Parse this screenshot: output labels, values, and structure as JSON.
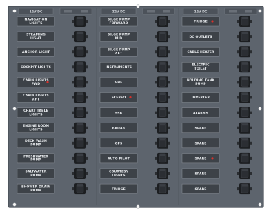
{
  "panel": {
    "header_label": "12V DC",
    "colors": {
      "panel": "#5d646d",
      "panel_edge": "#454b53",
      "label_plate": "#3d4248",
      "label_border": "#8a9098",
      "text": "#e9ecef",
      "led_red": "#d8322c",
      "switch_body": "#1c1e21",
      "switch_rocker": "#2b2e33",
      "screw": "#f4f4f4"
    }
  },
  "columns": [
    {
      "header": "12V DC",
      "items": [
        {
          "label": [
            "NAVIGATION",
            "LIGHTS"
          ],
          "led": false
        },
        {
          "label": [
            "STEAMING",
            "LIGHT"
          ],
          "led": false
        },
        {
          "label": [
            "ANCHOR LIGHT"
          ],
          "led": false
        },
        {
          "label": [
            "COCKPIT LIGHTS"
          ],
          "led": false
        },
        {
          "label": [
            "CABIN LIGHTS",
            "FWD"
          ],
          "led": true
        },
        {
          "label": [
            "CABIN LIGHTS",
            "AFT"
          ],
          "led": false
        },
        {
          "label": [
            "CHART TABLE",
            "LIGHTS"
          ],
          "led": false
        },
        {
          "label": [
            "ENGINE ROOM",
            "LIGHTS"
          ],
          "led": false
        },
        {
          "label": [
            "DECK WASH",
            "PUMP"
          ],
          "led": false
        },
        {
          "label": [
            "FRESHWATER",
            "PUMP"
          ],
          "led": false
        },
        {
          "label": [
            "SALTWATER",
            "PUMP"
          ],
          "led": false
        },
        {
          "label": [
            "SHOWER DRAIN",
            "PUMP"
          ],
          "led": false
        }
      ]
    },
    {
      "header": "12V DC",
      "items": [
        {
          "label": [
            "BILGE PUMP",
            "FORWARD"
          ],
          "led": false
        },
        {
          "label": [
            "BILGE PUMP",
            "MID"
          ],
          "led": false
        },
        {
          "label": [
            "BILGE PUMP",
            "AFT"
          ],
          "led": false
        },
        {
          "label": [
            "INSTRUMENTS"
          ],
          "led": false
        },
        {
          "label": [
            "VHF"
          ],
          "led": false
        },
        {
          "label": [
            "STEREO"
          ],
          "led": true
        },
        {
          "label": [
            "SSB"
          ],
          "led": false
        },
        {
          "label": [
            "RADAR"
          ],
          "led": false
        },
        {
          "label": [
            "GPS"
          ],
          "led": false
        },
        {
          "label": [
            "AUTO PILOT"
          ],
          "led": false
        },
        {
          "label": [
            "COURTESY",
            "LIGHTS"
          ],
          "led": false
        },
        {
          "label": [
            "FRIDGE"
          ],
          "led": false
        }
      ]
    },
    {
      "header": "12V DC",
      "items": [
        {
          "label": [
            "FRIDGE"
          ],
          "led": true
        },
        {
          "label": [
            "DC OUTLETS"
          ],
          "led": false
        },
        {
          "label": [
            "CABLE HEATER"
          ],
          "led": false
        },
        {
          "label": [
            "ELECTRIC",
            "TOILET"
          ],
          "led": false
        },
        {
          "label": [
            "HOLDING TANK",
            "PUMP"
          ],
          "led": false
        },
        {
          "label": [
            "INVERTER"
          ],
          "led": false
        },
        {
          "label": [
            "ALARMS"
          ],
          "led": false
        },
        {
          "label": [
            "SPARE"
          ],
          "led": false
        },
        {
          "label": [
            "SPARE"
          ],
          "led": false
        },
        {
          "label": [
            "SPARE"
          ],
          "led": true
        },
        {
          "label": [
            "SPARE"
          ],
          "led": false
        },
        {
          "label": [
            "SPARE"
          ],
          "led": false
        }
      ]
    }
  ]
}
